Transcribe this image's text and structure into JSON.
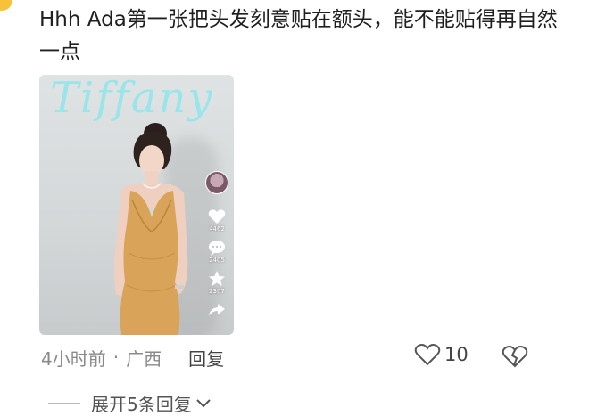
{
  "comment": {
    "text": "Hhh  Ada第一张把头发刻意贴在额头，能不能贴得再自然一点"
  },
  "image": {
    "brand_watermark": "Tiffany"
  },
  "video_overlay": {
    "like_count": "4462",
    "comment_count": "2405",
    "favorite_count": "2307"
  },
  "meta": {
    "time": "4小时前",
    "separator": "·",
    "location": "广西",
    "reply_label": "回复"
  },
  "actions": {
    "like_count": "10"
  },
  "expand": {
    "label": "展开5条回复"
  },
  "colors": {
    "watermark": "#8fe6ec",
    "dress": "#d9a45a"
  }
}
